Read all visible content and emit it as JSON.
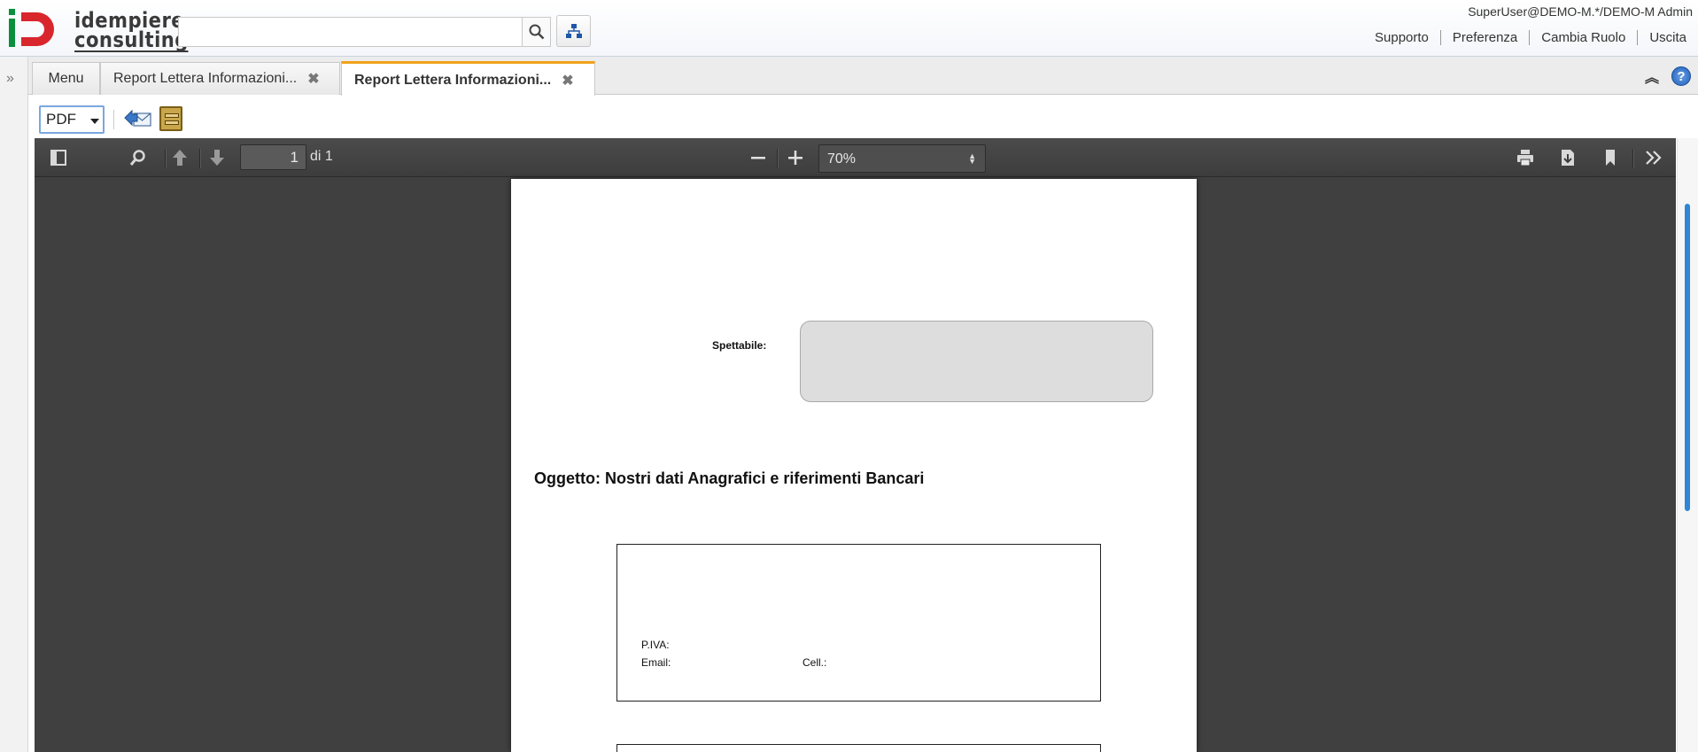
{
  "header": {
    "logo_text_line1": "idempiere",
    "logo_text_line2": "consulting",
    "search_placeholder": "",
    "user": "SuperUser@DEMO-M.*/DEMO-M Admin",
    "links": [
      "Supporto",
      "Preferenza",
      "Cambia Ruolo",
      "Uscita"
    ]
  },
  "tabs": [
    {
      "label": "Menu",
      "closable": false
    },
    {
      "label": "Report Lettera Informazioni...",
      "closable": true
    },
    {
      "label": "Report Lettera Informazioni...",
      "closable": true,
      "active": true
    }
  ],
  "report_toolbar": {
    "format": "PDF"
  },
  "pdf_viewer": {
    "page_number": "1",
    "page_of": "di 1",
    "zoom": "70%"
  },
  "document": {
    "spettabile_label": "Spettabile:",
    "oggetto": "Oggetto: Nostri dati Anagrafici e riferimenti Bancari",
    "piva_label": "P.IVA:",
    "email_label": "Email:",
    "cell_label": "Cell.:"
  },
  "colors": {
    "active_tab_accent": "#f0a31c",
    "viewer_background": "#404040",
    "scroll_thumb": "#2f86d6"
  },
  "icons": [
    "expand-icon",
    "search-icon",
    "tree-icon",
    "collapse-icon",
    "help-icon",
    "email-icon",
    "archive-icon",
    "sidebar-toggle-icon",
    "find-icon",
    "previous-page-icon",
    "next-page-icon",
    "zoom-out-icon",
    "zoom-in-icon",
    "print-icon",
    "download-icon",
    "bookmark-icon",
    "tools-icon"
  ]
}
